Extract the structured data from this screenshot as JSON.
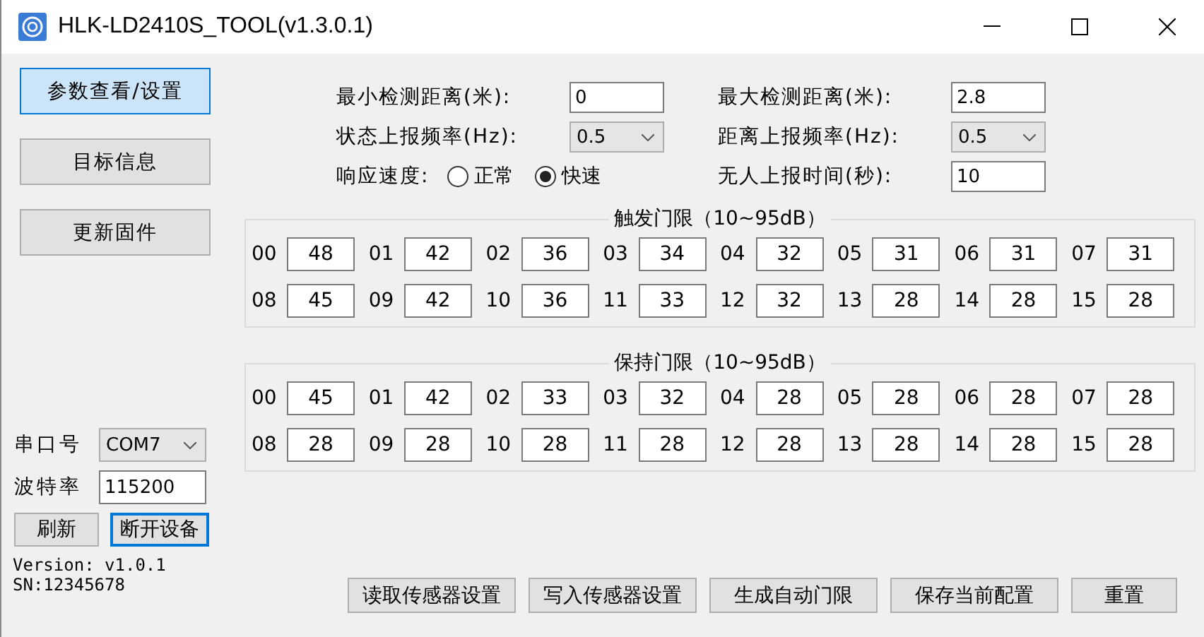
{
  "window": {
    "title": "HLK-LD2410S_TOOL(v1.3.0.1)"
  },
  "nav": [
    {
      "label": "参数查看/设置",
      "selected": true
    },
    {
      "label": "目标信息",
      "selected": false
    },
    {
      "label": "更新固件",
      "selected": false
    }
  ],
  "serial": {
    "port_label": "串口号",
    "port": "COM7",
    "baud_label": "波特率",
    "baud": "115200",
    "buttons": [
      {
        "label": "刷新",
        "focused": false
      },
      {
        "label": "断开设备",
        "focused": true
      }
    ]
  },
  "version": "Version: v1.0.1",
  "sn": "SN:12345678",
  "params": [
    {
      "kind": "input",
      "label": "最小检测距离(米):",
      "value": "0"
    },
    {
      "kind": "input",
      "label": "最大检测距离(米):",
      "value": "2.8"
    },
    {
      "kind": "select",
      "label": "状态上报频率(Hz):",
      "value": "0.5"
    },
    {
      "kind": "select",
      "label": "距离上报频率(Hz):",
      "value": "0.5"
    },
    {
      "kind": "radio",
      "label": "响应速度:",
      "options": [
        {
          "label": "正常",
          "selected": false
        },
        {
          "label": "快速",
          "selected": true
        }
      ]
    },
    {
      "kind": "input",
      "label": "无人上报时间(秒):",
      "value": "10"
    }
  ],
  "groups": [
    {
      "title": "触发门限（10~95dB）",
      "gates": [
        {
          "index": "00",
          "value": "48"
        },
        {
          "index": "01",
          "value": "42"
        },
        {
          "index": "02",
          "value": "36"
        },
        {
          "index": "03",
          "value": "34"
        },
        {
          "index": "04",
          "value": "32"
        },
        {
          "index": "05",
          "value": "31"
        },
        {
          "index": "06",
          "value": "31"
        },
        {
          "index": "07",
          "value": "31"
        },
        {
          "index": "08",
          "value": "45"
        },
        {
          "index": "09",
          "value": "42"
        },
        {
          "index": "10",
          "value": "36"
        },
        {
          "index": "11",
          "value": "33"
        },
        {
          "index": "12",
          "value": "32"
        },
        {
          "index": "13",
          "value": "28"
        },
        {
          "index": "14",
          "value": "28"
        },
        {
          "index": "15",
          "value": "28"
        }
      ]
    },
    {
      "title": "保持门限（10~95dB）",
      "gates": [
        {
          "index": "00",
          "value": "45"
        },
        {
          "index": "01",
          "value": "42"
        },
        {
          "index": "02",
          "value": "33"
        },
        {
          "index": "03",
          "value": "32"
        },
        {
          "index": "04",
          "value": "28"
        },
        {
          "index": "05",
          "value": "28"
        },
        {
          "index": "06",
          "value": "28"
        },
        {
          "index": "07",
          "value": "28"
        },
        {
          "index": "08",
          "value": "28"
        },
        {
          "index": "09",
          "value": "28"
        },
        {
          "index": "10",
          "value": "28"
        },
        {
          "index": "11",
          "value": "28"
        },
        {
          "index": "12",
          "value": "28"
        },
        {
          "index": "13",
          "value": "28"
        },
        {
          "index": "14",
          "value": "28"
        },
        {
          "index": "15",
          "value": "28"
        }
      ]
    }
  ],
  "actions": [
    "读取传感器设置",
    "写入传感器设置",
    "生成自动门限",
    "保存当前配置",
    "重置"
  ]
}
